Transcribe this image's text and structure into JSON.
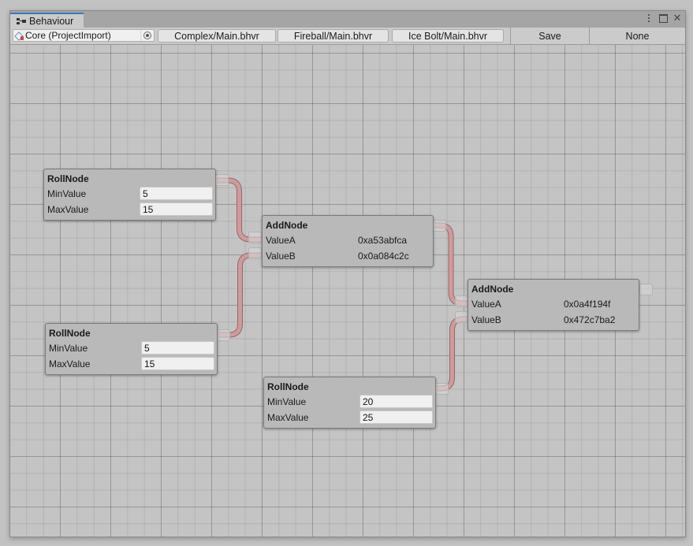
{
  "window": {
    "tab_title": "Behaviour",
    "tab_icon": "graph-icon",
    "controls": [
      "kebab-menu-icon",
      "maximize-icon",
      "close-icon"
    ],
    "close_glyph": "✕"
  },
  "toolbar": {
    "object_field": {
      "value": "Core (ProjectImport)",
      "icon": "prefab-icon",
      "picker_icon": "object-picker-icon"
    },
    "files": [
      "Complex/Main.bhvr",
      "Fireball/Main.bhvr",
      "Ice Bolt/Main.bhvr"
    ],
    "save_label": "Save",
    "none_label": "None"
  },
  "colors": {
    "edge": "#d19a9a",
    "edge_outline": "#8f6a6a",
    "accent_tab": "#3a79bb"
  },
  "graph": {
    "nodes": [
      {
        "id": "roll1",
        "title": "RollNode",
        "rows": [
          {
            "label": "MinValue",
            "value": "5",
            "editable": true
          },
          {
            "label": "MaxValue",
            "value": "15",
            "editable": true
          }
        ]
      },
      {
        "id": "roll2",
        "title": "RollNode",
        "rows": [
          {
            "label": "MinValue",
            "value": "5",
            "editable": true
          },
          {
            "label": "MaxValue",
            "value": "15",
            "editable": true
          }
        ]
      },
      {
        "id": "add1",
        "title": "AddNode",
        "rows": [
          {
            "label": "ValueA",
            "value": "0xa53abfca",
            "editable": false
          },
          {
            "label": "ValueB",
            "value": "0x0a084c2c",
            "editable": false
          }
        ]
      },
      {
        "id": "add2",
        "title": "AddNode",
        "rows": [
          {
            "label": "ValueA",
            "value": "0x0a4f194f",
            "editable": false
          },
          {
            "label": "ValueB",
            "value": "0x472c7ba2",
            "editable": false
          }
        ]
      },
      {
        "id": "roll3",
        "title": "RollNode",
        "rows": [
          {
            "label": "MinValue",
            "value": "20",
            "editable": true
          },
          {
            "label": "MaxValue",
            "value": "25",
            "editable": true
          }
        ]
      }
    ],
    "connections": [
      {
        "from": "roll1",
        "to": "add1",
        "to_port": "ValueA"
      },
      {
        "from": "roll2",
        "to": "add1",
        "to_port": "ValueB"
      },
      {
        "from": "add1",
        "to": "add2",
        "to_port": "ValueA"
      },
      {
        "from": "roll3",
        "to": "add2",
        "to_port": "ValueB"
      }
    ]
  }
}
